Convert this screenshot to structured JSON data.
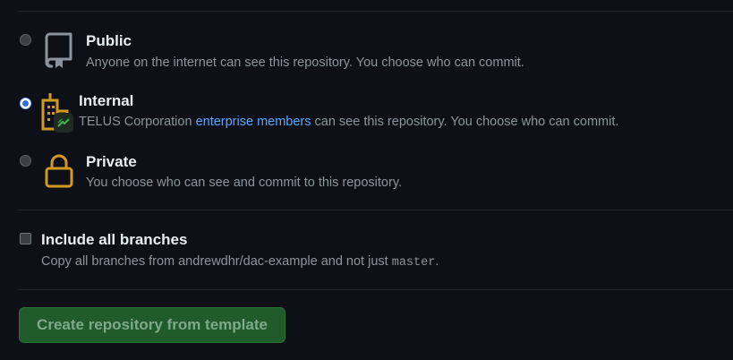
{
  "visibility": {
    "options": [
      {
        "title": "Public",
        "description": "Anyone on the internet can see this repository. You choose who can commit.",
        "selected": false,
        "icon": "repo-icon"
      },
      {
        "title": "Internal",
        "description_prefix": "TELUS Corporation ",
        "link": "enterprise members",
        "description_suffix": " can see this repository. You choose who can commit.",
        "selected": true,
        "icon": "organization-icon"
      },
      {
        "title": "Private",
        "description": "You choose who can see and commit to this repository.",
        "selected": false,
        "icon": "lock-icon"
      }
    ]
  },
  "branches": {
    "label": "Include all branches",
    "description_prefix": "Copy all branches from andrewdhr/dac-example and not just ",
    "code": "master",
    "description_suffix": ".",
    "checked": false
  },
  "submit": {
    "label": "Create repository from template"
  },
  "colors": {
    "background": "#0d1117",
    "link": "#58a6ff",
    "icon_warning": "#d29922",
    "button": "#1f5b2b"
  }
}
